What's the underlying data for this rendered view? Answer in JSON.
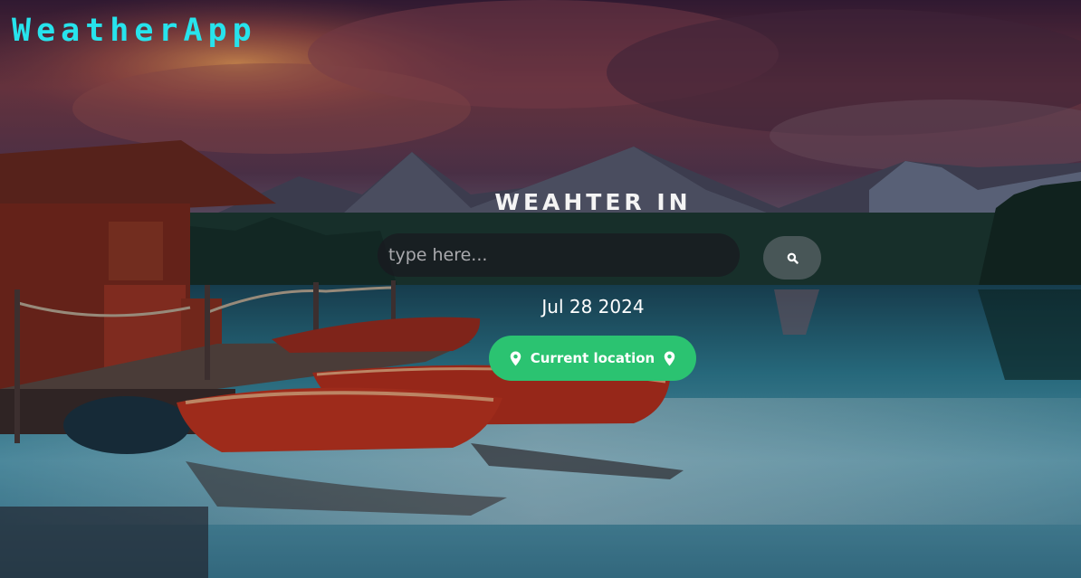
{
  "header": {
    "brand": "WeatherApp"
  },
  "main": {
    "heading": "WEAHTER IN",
    "search": {
      "placeholder": "type here...",
      "value": "",
      "button_icon": "search-icon"
    },
    "date": "Jul 28 2024",
    "location_button": {
      "label": "Current location",
      "icon": "map-pin-icon"
    }
  },
  "colors": {
    "brand": "#27e3ec",
    "location_button": "#2bc371",
    "heading_text": "#f4f4f4"
  }
}
